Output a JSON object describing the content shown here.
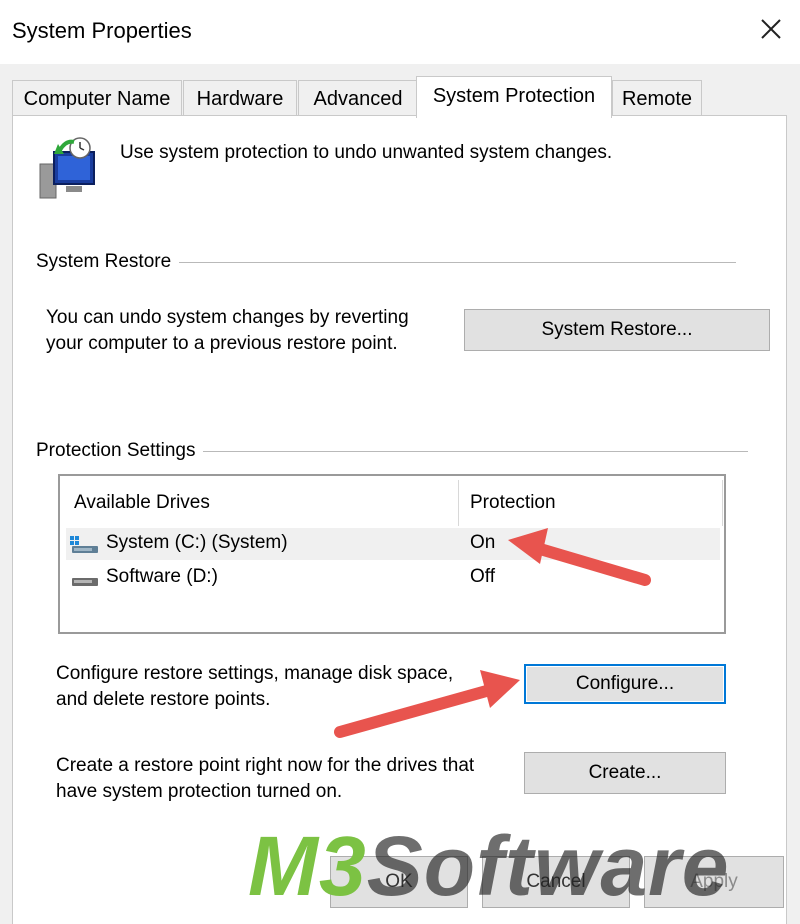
{
  "window": {
    "title": "System Properties"
  },
  "tabs": [
    {
      "label": "Computer Name"
    },
    {
      "label": "Hardware"
    },
    {
      "label": "Advanced"
    },
    {
      "label": "System Protection"
    },
    {
      "label": "Remote"
    }
  ],
  "active_tab": "System Protection",
  "intro": {
    "text": "Use system protection to undo unwanted system changes.",
    "icon": "system-protection-icon"
  },
  "system_restore": {
    "group_title": "System Restore",
    "description_line1": "You can undo system changes by reverting",
    "description_line2": "your computer to a previous restore point.",
    "button_label": "System Restore..."
  },
  "protection_settings": {
    "group_title": "Protection Settings",
    "columns": [
      "Available Drives",
      "Protection"
    ],
    "drives": [
      {
        "name": "System (C:) (System)",
        "protection": "On",
        "icon": "system-drive-icon"
      },
      {
        "name": "Software (D:)",
        "protection": "Off",
        "icon": "drive-icon"
      }
    ],
    "configure_desc_line1": "Configure restore settings, manage disk space,",
    "configure_desc_line2": "and delete restore points.",
    "configure_label": "Configure...",
    "create_desc_line1": "Create a restore point right now for the drives that",
    "create_desc_line2": "have system protection turned on.",
    "create_label": "Create..."
  },
  "footer": {
    "ok_label": "OK",
    "cancel_label": "Cancel",
    "apply_label": "Apply"
  },
  "watermark": {
    "part1": "M3",
    "part2": "Software"
  },
  "colors": {
    "accent": "#0078d7",
    "arrow": "#e8544e",
    "watermark_green": "#7cc243"
  }
}
